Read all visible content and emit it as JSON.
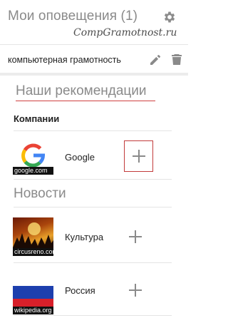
{
  "header": {
    "title": "Мои оповещения (1)",
    "watermark": "CompGramotnost.ru"
  },
  "alert": {
    "label": "компьютерная грамотность"
  },
  "recommendations": {
    "title": "Наши рекомендации",
    "companies_heading": "Компании",
    "companies": [
      {
        "label": "Google",
        "thumb_caption": "google.com",
        "icon": "google-logo"
      }
    ],
    "news_heading": "Новости",
    "news": [
      {
        "label": "Культура",
        "thumb_caption": "circusreno.com",
        "icon": "concert-photo"
      },
      {
        "label": "Россия",
        "thumb_caption": "wikipedia.org",
        "icon": "russia-flag"
      }
    ]
  },
  "colors": {
    "accent": "#c23b3b",
    "muted_text": "#8a8a8a"
  }
}
